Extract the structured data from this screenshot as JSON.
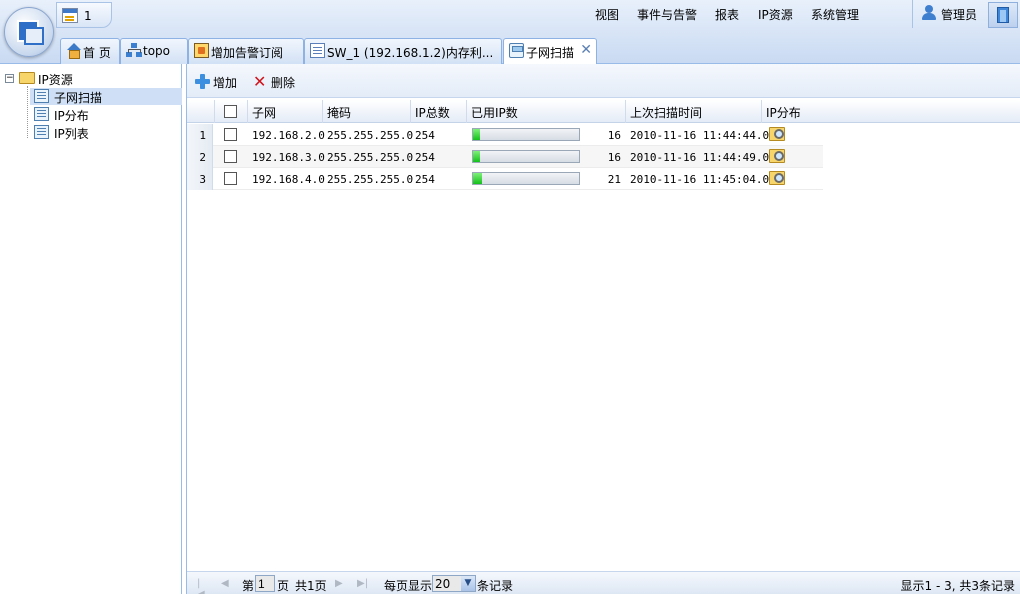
{
  "header": {
    "message_count": "1",
    "nav": [
      "视图",
      "事件与告警",
      "报表",
      "IP资源",
      "系统管理"
    ],
    "user": "管理员"
  },
  "tabs": [
    {
      "label": "首 页",
      "icon": "home-icon"
    },
    {
      "label": "topo",
      "icon": "topology-icon"
    },
    {
      "label": "增加告警订阅",
      "icon": "alarm-icon"
    },
    {
      "label": "SW_1 (192.168.1.2)内存利...",
      "icon": "list-icon"
    },
    {
      "label": "子网扫描",
      "icon": "network-icon",
      "active": true,
      "close": "✕"
    }
  ],
  "tree": {
    "root": "IP资源",
    "toggle": "−",
    "children": [
      "子网扫描",
      "IP分布",
      "IP列表"
    ]
  },
  "toolbar": {
    "add": "增加",
    "delete": "删除"
  },
  "grid": {
    "headers": [
      "子网",
      "掩码",
      "IP总数",
      "已用IP数",
      "上次扫描时间",
      "IP分布"
    ],
    "rows": [
      {
        "num": "1",
        "subnet": "192.168.2.0",
        "mask": "255.255.255.0",
        "total": "254",
        "used": "16",
        "used_fraction": 0.063,
        "time": "2010-11-16 11:44:44.0"
      },
      {
        "num": "2",
        "subnet": "192.168.3.0",
        "mask": "255.255.255.0",
        "total": "254",
        "used": "16",
        "used_fraction": 0.063,
        "time": "2010-11-16 11:44:49.0"
      },
      {
        "num": "3",
        "subnet": "192.168.4.0",
        "mask": "255.255.255.0",
        "total": "254",
        "used": "21",
        "used_fraction": 0.083,
        "time": "2010-11-16 11:45:04.0"
      }
    ]
  },
  "pager": {
    "page_prefix": "第",
    "page_value": "1",
    "page_suffix": "页",
    "total_pages": "共1页",
    "per_page_label": "每页显示",
    "per_page_value": "20",
    "per_page_suffix": "条记录",
    "summary": "显示1 - 3, 共3条记录"
  }
}
